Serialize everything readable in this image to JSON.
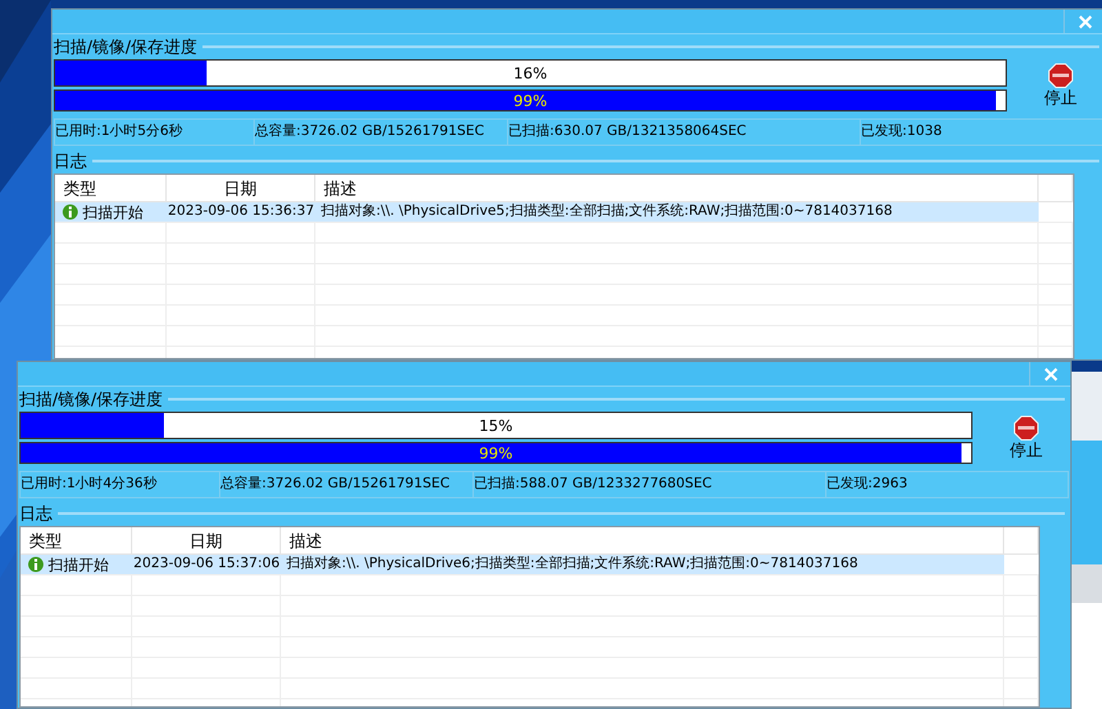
{
  "windows": [
    {
      "progress_group_label": "扫描/镜像/保存进度",
      "progress_bars": [
        {
          "label": "16%",
          "level": 0.16
        },
        {
          "label": "99%",
          "level": 0.99
        }
      ],
      "stop_button": "停止",
      "stats": [
        "已用时:1小时5分6秒",
        "总容量:3726.02 GB/15261791SEC",
        "已扫描:630.07 GB/1321358064SEC",
        "已发现:1038"
      ],
      "log_group_label": "日志",
      "log_table": {
        "columns": [
          "类型",
          "日期",
          "描述"
        ],
        "rows": [
          {
            "type": "扫描开始",
            "date": "2023-09-06 15:36:37",
            "description": "扫描对象:\\\\. \\PhysicalDrive5;扫描类型:全部扫描;文件系统:RAW;扫描范围:0~7814037168",
            "selected": true
          }
        ]
      }
    },
    {
      "progress_group_label": "扫描/镜像/保存进度",
      "progress_bars": [
        {
          "label": "15%",
          "level": 0.15
        },
        {
          "label": "99%",
          "level": 0.99
        }
      ],
      "stop_button": "停止",
      "stats": [
        "已用时:1小时4分36秒",
        "总容量:3726.02 GB/15261791SEC",
        "已扫描:588.07 GB/1233277680SEC",
        "已发现:2963"
      ],
      "log_group_label": "日志",
      "log_table": {
        "columns": [
          "类型",
          "日期",
          "描述"
        ],
        "rows": [
          {
            "type": "扫描开始",
            "date": "2023-09-06 15:37:06",
            "description": "扫描对象:\\\\. \\PhysicalDrive6;扫描类型:全部扫描;文件系统:RAW;扫描范围:0~7814037168",
            "selected": true
          }
        ]
      }
    }
  ]
}
